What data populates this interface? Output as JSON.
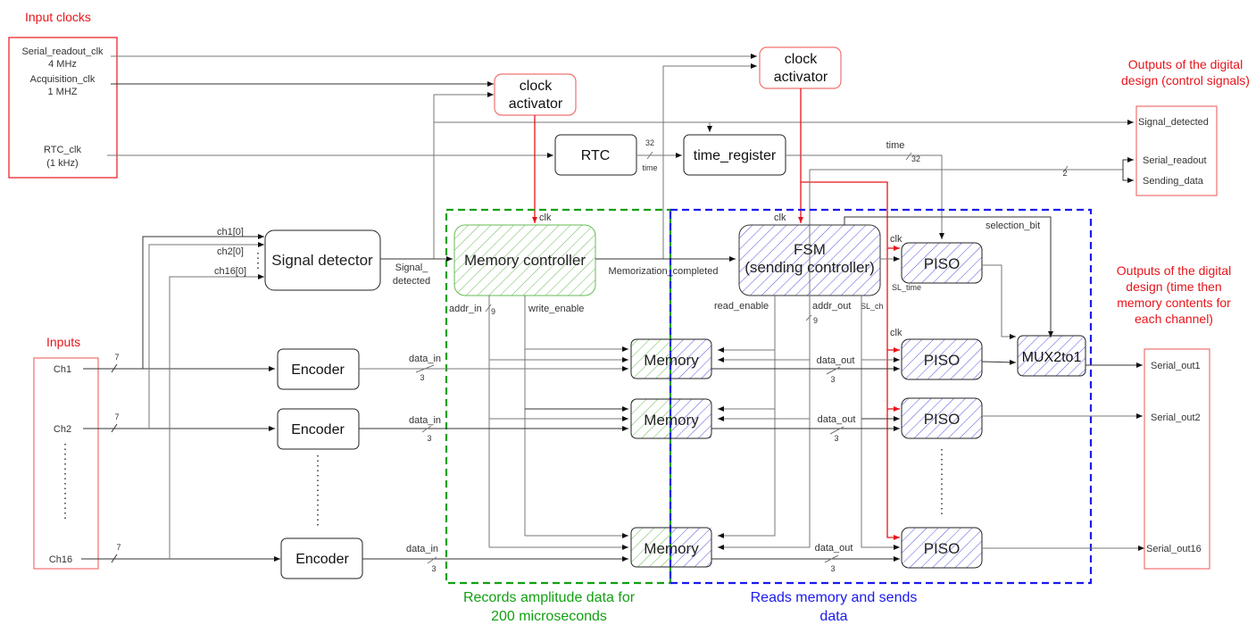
{
  "colors": {
    "red": "#e8141a",
    "green": "#12a012",
    "blue": "#1a1aee",
    "green_hatch": "#66bb55",
    "blue_hatch": "#5555dd"
  },
  "headings": {
    "input_clocks": "Input clocks",
    "inputs": "Inputs",
    "outputs_control_1": "Outputs of the digital",
    "outputs_control_2": "design (control signals)",
    "outputs_data_1": "Outputs of the digital",
    "outputs_data_2": "design (time then",
    "outputs_data_3": "memory contents for",
    "outputs_data_4": "each channel)"
  },
  "clocks": {
    "serial_readout_clk": "Serial_readout_clk",
    "serial_freq": "4 MHz",
    "acquisition_clk": "Acquisition_clk",
    "acq_freq": "1 MHZ",
    "rtc_clk": "RTC_clk",
    "rtc_freq": "(1 kHz)"
  },
  "inputs": {
    "ch1": "Ch1",
    "ch2": "Ch2",
    "ch16": "Ch16",
    "bus_width": "7"
  },
  "blocks": {
    "clock_activator_1": "clock",
    "clock_activator_2": "activator",
    "rtc": "RTC",
    "time_register": "time_register",
    "signal_detector": "Signal detector",
    "memory_controller": "Memory controller",
    "fsm_1": "FSM",
    "fsm_2": "(sending controller)",
    "encoder": "Encoder",
    "memory": "Memory",
    "piso": "PISO",
    "mux": "MUX2to1"
  },
  "signals": {
    "ch1_bit": "ch1[0]",
    "ch2_bit": "ch2[0]",
    "ch16_bit": "ch16[0]",
    "signal_detected_1": "Signal_",
    "signal_detected_2": "detected",
    "memorization_completed": "Memorization_completed",
    "clk": "clk",
    "addr_in": "addr_in",
    "addr_width": "9",
    "write_enable": "write_enable",
    "read_enable": "read_enable",
    "addr_out": "addr_out",
    "sl_ch": "SL_ch",
    "sl_time": "SL_time",
    "selection_bit": "selection_bit",
    "time": "time",
    "time_width": "32",
    "two_width": "2",
    "data_in": "data_in",
    "data_out": "data_out",
    "data_width": "3"
  },
  "outputs_control": {
    "signal_detected": "Signal_detected",
    "serial_readout": "Serial_readout",
    "sending_data": "Sending_data"
  },
  "outputs_data": {
    "serial_out1": "Serial_out1",
    "serial_out2": "Serial_out2",
    "serial_out16": "Serial_out16"
  },
  "regions": {
    "green_1": "Records amplitude data for",
    "green_2": "200 microseconds",
    "blue_1": "Reads memory and sends",
    "blue_2": "data"
  }
}
